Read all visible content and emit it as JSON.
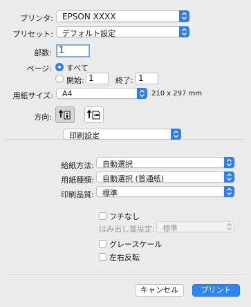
{
  "printer": {
    "label": "プリンタ:",
    "value": "EPSON XXXX"
  },
  "preset": {
    "label": "プリセット:",
    "value": "デフォルト設定"
  },
  "copies": {
    "label": "部数:",
    "value": "1"
  },
  "pages": {
    "label": "ページ:",
    "all": "すべて",
    "start_label": "開始:",
    "start_value": "1",
    "end_label": "終了:",
    "end_value": "1"
  },
  "paper_size": {
    "label": "用紙サイズ:",
    "value": "A4",
    "dimensions": "210 x 297 mm"
  },
  "orientation": {
    "label": "方向:"
  },
  "section": {
    "value": "印刷設定"
  },
  "paper_source": {
    "label": "給紙方法:",
    "value": "自動選択"
  },
  "media_type": {
    "label": "用紙種類:",
    "value": "自動選択 (普通紙)"
  },
  "print_quality": {
    "label": "印刷品質:",
    "value": "標準"
  },
  "borderless": {
    "label": "フチなし"
  },
  "expansion": {
    "label": "はみ出し量設定:",
    "value": "標準"
  },
  "grayscale": {
    "label": "グレースケール"
  },
  "mirror": {
    "label": "左右反転"
  },
  "buttons": {
    "cancel": "キャンセル",
    "print": "プリント"
  }
}
